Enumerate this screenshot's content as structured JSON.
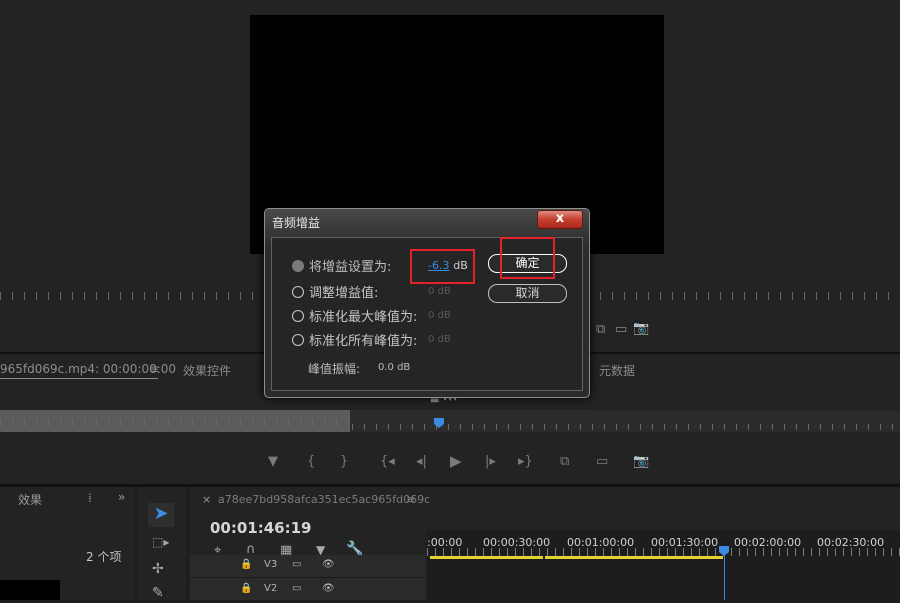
{
  "colors": {
    "accent": "#3b8be0",
    "highlight": "#e4222b",
    "clip_bar": "#e3d32c"
  },
  "source_monitor": {
    "clip_tab": "965fd069c.mp4: 00:00:00:00"
  },
  "tabs": {
    "effect_controls": "效果控件",
    "metadata": "元数据"
  },
  "effects_panel": {
    "title": "效果",
    "items_count": "2 个项"
  },
  "timeline": {
    "sequence_name": "a78ee7bd958afca351ec5ac965fd069c",
    "timecode": "00:01:46:19",
    "ruler_labels": [
      ":00:00",
      "00:00:30:00",
      "00:01:00:00",
      "00:01:30:00",
      "00:02:00:00",
      "00:02:30:00"
    ],
    "tracks": [
      "V3",
      "V2"
    ]
  },
  "dialog": {
    "title": "音频增益",
    "close_label": "x",
    "options": [
      {
        "label": "将增益设置为:",
        "value": "-6.3",
        "unit": "dB",
        "selected": true
      },
      {
        "label": "调整增益值:",
        "value": "0 dB",
        "selected": false
      },
      {
        "label": "标准化最大峰值为:",
        "value": "0 dB",
        "selected": false
      },
      {
        "label": "标准化所有峰值为:",
        "value": "0 dB",
        "selected": false
      }
    ],
    "peak_label": "峰值振幅:",
    "peak_value": "0.0 dB",
    "ok_label": "确定",
    "cancel_label": "取消"
  }
}
